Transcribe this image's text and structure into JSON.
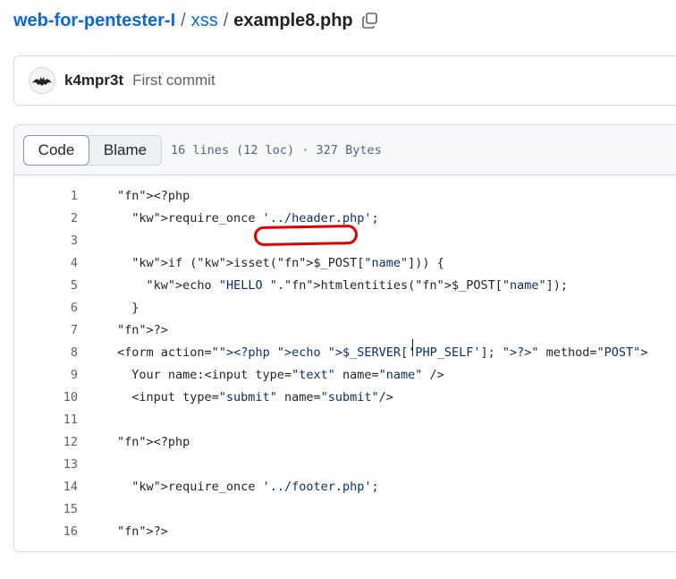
{
  "breadcrumb": {
    "repo": "web-for-pentester-I",
    "separator": "/",
    "dir": "xss",
    "file": "example8.php",
    "copy_icon": "copy-icon"
  },
  "commit": {
    "author": "k4mpr3t",
    "message": "First commit",
    "avatar_icon": "bat-avatar"
  },
  "file_header": {
    "tabs": [
      "Code",
      "Blame"
    ],
    "active_tab": "Code",
    "info": "16 lines (12 loc) · 327 Bytes"
  },
  "code_lines": [
    {
      "n": "1",
      "text": "<?php"
    },
    {
      "n": "2",
      "text": "  require_once '../header.php';"
    },
    {
      "n": "3",
      "text": ""
    },
    {
      "n": "4",
      "text": "  if (isset($_POST[\"name\"])) {"
    },
    {
      "n": "5",
      "text": "    echo \"HELLO \".htmlentities($_POST[\"name\"]);"
    },
    {
      "n": "6",
      "text": "  }"
    },
    {
      "n": "7",
      "text": "?>"
    },
    {
      "n": "8",
      "text": "<form action=\"<?php echo $_SERVER['PHP_SELF']; ?>\" method=\"POST\">"
    },
    {
      "n": "9",
      "text": "  Your name:<input type=\"text\" name=\"name\" />"
    },
    {
      "n": "10",
      "text": "  <input type=\"submit\" name=\"submit\"/>"
    },
    {
      "n": "11",
      "text": ""
    },
    {
      "n": "12",
      "text": "<?php"
    },
    {
      "n": "13",
      "text": ""
    },
    {
      "n": "14",
      "text": "  require_once '../footer.php';"
    },
    {
      "n": "15",
      "text": ""
    },
    {
      "n": "16",
      "text": "?>"
    }
  ],
  "annotation": {
    "color": "#e00000",
    "target": "htmlentities"
  }
}
